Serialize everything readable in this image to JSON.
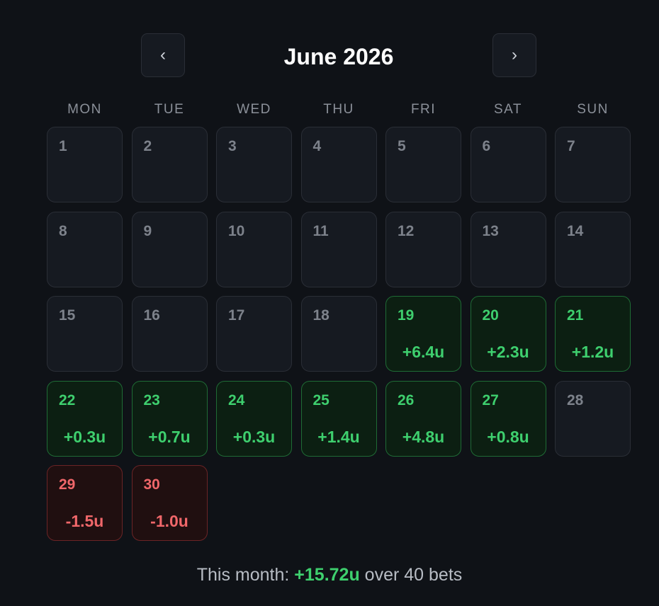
{
  "header": {
    "title": "June 2026",
    "prev_label": "‹",
    "next_label": "›"
  },
  "weekdays": [
    "MON",
    "TUE",
    "WED",
    "THU",
    "FRI",
    "SAT",
    "SUN"
  ],
  "days": [
    {
      "day": "1",
      "amount": "",
      "status": "empty"
    },
    {
      "day": "2",
      "amount": "",
      "status": "empty"
    },
    {
      "day": "3",
      "amount": "",
      "status": "empty"
    },
    {
      "day": "4",
      "amount": "",
      "status": "empty"
    },
    {
      "day": "5",
      "amount": "",
      "status": "empty"
    },
    {
      "day": "6",
      "amount": "",
      "status": "empty"
    },
    {
      "day": "7",
      "amount": "",
      "status": "empty"
    },
    {
      "day": "8",
      "amount": "",
      "status": "empty"
    },
    {
      "day": "9",
      "amount": "",
      "status": "empty"
    },
    {
      "day": "10",
      "amount": "",
      "status": "empty"
    },
    {
      "day": "11",
      "amount": "",
      "status": "empty"
    },
    {
      "day": "12",
      "amount": "",
      "status": "empty"
    },
    {
      "day": "13",
      "amount": "",
      "status": "empty"
    },
    {
      "day": "14",
      "amount": "",
      "status": "empty"
    },
    {
      "day": "15",
      "amount": "",
      "status": "empty"
    },
    {
      "day": "16",
      "amount": "",
      "status": "empty"
    },
    {
      "day": "17",
      "amount": "",
      "status": "empty"
    },
    {
      "day": "18",
      "amount": "",
      "status": "empty"
    },
    {
      "day": "19",
      "amount": "+6.4u",
      "status": "win"
    },
    {
      "day": "20",
      "amount": "+2.3u",
      "status": "win"
    },
    {
      "day": "21",
      "amount": "+1.2u",
      "status": "win"
    },
    {
      "day": "22",
      "amount": "+0.3u",
      "status": "win"
    },
    {
      "day": "23",
      "amount": "+0.7u",
      "status": "win"
    },
    {
      "day": "24",
      "amount": "+0.3u",
      "status": "win"
    },
    {
      "day": "25",
      "amount": "+1.4u",
      "status": "win"
    },
    {
      "day": "26",
      "amount": "+4.8u",
      "status": "win"
    },
    {
      "day": "27",
      "amount": "+0.8u",
      "status": "win"
    },
    {
      "day": "28",
      "amount": "",
      "status": "empty"
    },
    {
      "day": "29",
      "amount": "-1.5u",
      "status": "loss"
    },
    {
      "day": "30",
      "amount": "-1.0u",
      "status": "loss"
    }
  ],
  "summary": {
    "prefix": "This month: ",
    "total": "+15.72u",
    "suffix": " over 40 bets"
  },
  "colors": {
    "background": "#0f1217",
    "win": "#3ecf6e",
    "loss": "#f0676a"
  }
}
